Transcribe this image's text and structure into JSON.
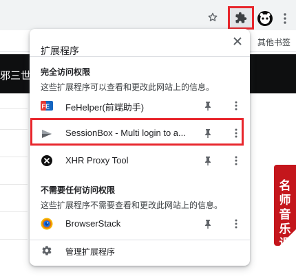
{
  "toolbar": {
    "star_icon": "star-outline-icon",
    "extensions_icon": "puzzle-piece-icon",
    "avatar_icon": "profile-avatar-icon",
    "menu_icon": "vertical-dots-icon",
    "highlight_color": "#e8262c"
  },
  "bookmarks_bar": {
    "other_bookmarks": "其他书签"
  },
  "page": {
    "nav_partial_text": "邪三世 ∨",
    "side_banner": [
      "名",
      "师",
      "音",
      "乐",
      "课"
    ]
  },
  "extensions_popup": {
    "title": "扩展程序",
    "close_icon": "close-icon",
    "sections": [
      {
        "title": "完全访问权限",
        "description": "这些扩展程序可以查看和更改此网站上的信息。",
        "items": [
          {
            "name": "FeHelper(前端助手)",
            "icon": "fehelper-icon"
          },
          {
            "name": "SessionBox - Multi login to a...",
            "icon": "sessionbox-icon"
          },
          {
            "name": "XHR Proxy Tool",
            "icon": "xhr-proxy-icon"
          }
        ]
      },
      {
        "title": "不需要任何访问权限",
        "description": "这些扩展程序不需要查看和更改此网站上的信息。",
        "items": [
          {
            "name": "BrowserStack",
            "icon": "browserstack-icon"
          }
        ]
      }
    ],
    "manage_label": "管理扩展程序",
    "manage_icon": "gear-icon"
  }
}
